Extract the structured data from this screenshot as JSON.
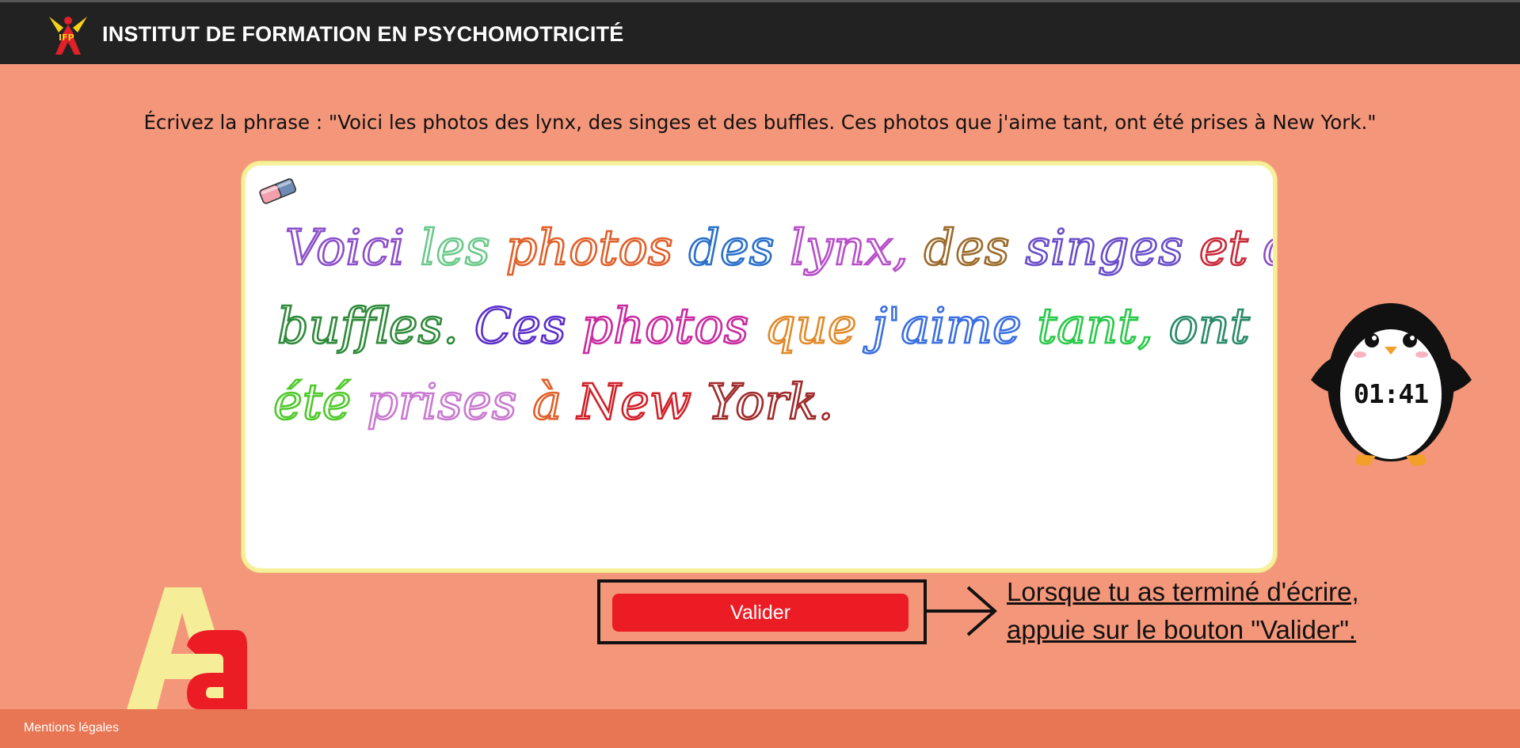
{
  "header": {
    "title": "INSTITUT DE FORMATION EN PSYCHOMOTRICITÉ",
    "logo_icon": "ifp-logo-icon"
  },
  "exercise": {
    "instruction": "Écrivez la phrase : \"Voici les photos des lynx, des singes et des buffles. Ces photos que j'aime tant, ont été prises à New York.\"",
    "eraser_icon": "eraser-icon",
    "handwritten_lines": [
      "Voici les photos des lynx, des singes et des",
      "buffles. Ces photos que j'aime tant, ont",
      "été prises à New York."
    ],
    "timer": "01:41",
    "mascot_icon": "penguin-icon"
  },
  "actions": {
    "validate_label": "Valider",
    "hint_line1": "Lorsque tu as terminé d'écrire,",
    "hint_line2": "appuie sur le bouton \"Valider\"."
  },
  "footer": {
    "legal_link": "Mentions légales"
  },
  "colors": {
    "background": "#f4967a",
    "topbar": "#222222",
    "button": "#ec1c24",
    "board_border": "#f7f09a",
    "footer": "#e87553"
  }
}
